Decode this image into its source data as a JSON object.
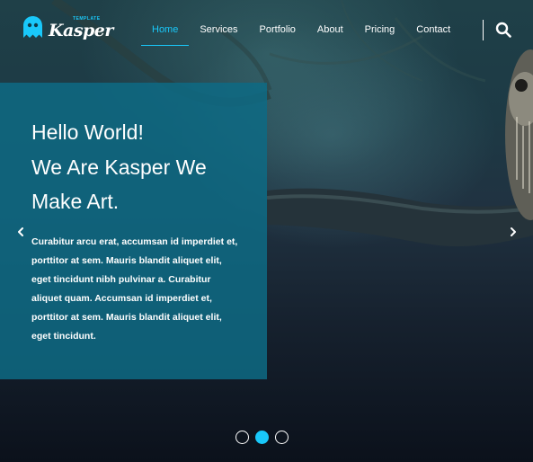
{
  "brand": {
    "name": "Kasper",
    "tag": "TEMPLATE",
    "accent_color": "#19c8fa"
  },
  "nav": {
    "items": [
      {
        "label": "Home",
        "active": true
      },
      {
        "label": "Services",
        "active": false
      },
      {
        "label": "Portfolio",
        "active": false
      },
      {
        "label": "About",
        "active": false
      },
      {
        "label": "Pricing",
        "active": false
      },
      {
        "label": "Contact",
        "active": false
      }
    ],
    "search_icon": "search-icon"
  },
  "hero": {
    "headline_lines": [
      "Hello World!",
      "We Are Kasper We",
      "Make Art."
    ],
    "body": "Curabitur arcu erat, accumsan id imperdiet et, porttitor at sem. Mauris blandit aliquet elit, eget tincidunt nibh pulvinar a. Curabitur aliquet quam. Accumsan id imperdiet et, porttitor at sem. Mauris blandit aliquet elit, eget tincidunt.",
    "panel_color": "#0e6a84",
    "prev_icon": "chevron-left-icon",
    "next_icon": "chevron-right-icon"
  },
  "slider": {
    "slide_count": 3,
    "active_slide": 2
  }
}
